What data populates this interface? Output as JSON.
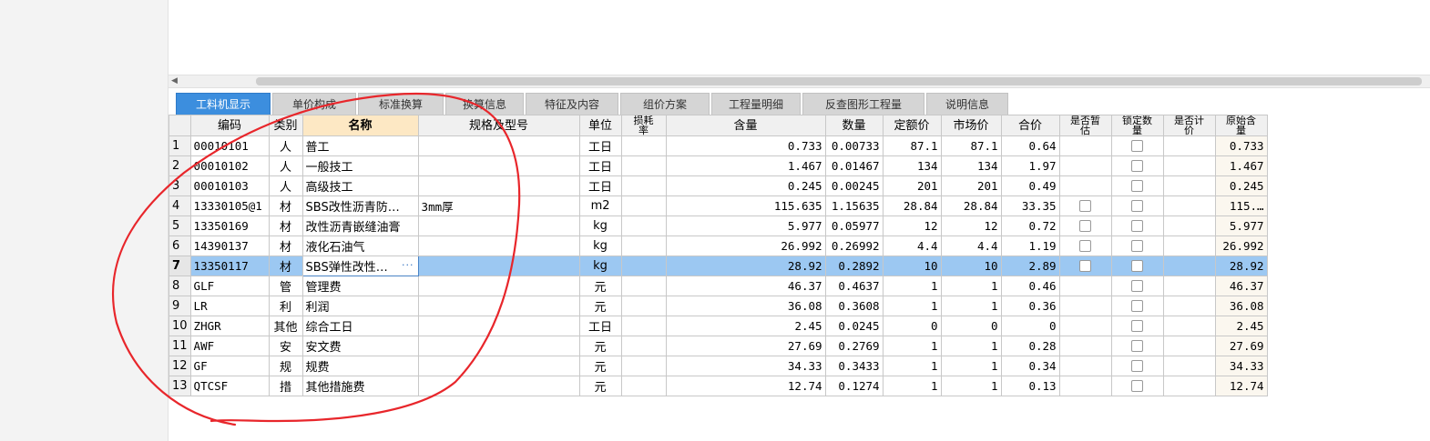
{
  "tabs": [
    {
      "label": "工料机显示",
      "active": true
    },
    {
      "label": "单价构成",
      "active": false
    },
    {
      "label": "标准换算",
      "active": false
    },
    {
      "label": "换算信息",
      "active": false
    },
    {
      "label": "特征及内容",
      "active": false
    },
    {
      "label": "组价方案",
      "active": false
    },
    {
      "label": "工程量明细",
      "active": false
    },
    {
      "label": "反查图形工程量",
      "active": false
    },
    {
      "label": "说明信息",
      "active": false
    }
  ],
  "columns": {
    "code": "编码",
    "type": "类别",
    "name": "名称",
    "spec": "规格及型号",
    "unit": "单位",
    "loss_top": "损耗",
    "loss_bot": "率",
    "content": "含量",
    "qty": "数量",
    "quota_price": "定额价",
    "market_price": "市场价",
    "total": "合价",
    "est_top": "是否暂",
    "est_bot": "估",
    "lock_top": "锁定数",
    "lock_bot": "量",
    "price_top": "是否计",
    "price_bot": "价",
    "orig_top": "原始含",
    "orig_bot": "量"
  },
  "rows": [
    {
      "rn": "1",
      "code": "00010101",
      "type": "人",
      "name": "普工",
      "spec": "",
      "unit": "工日",
      "content": "0.733",
      "qty": "0.00733",
      "quota": "87.1",
      "market": "87.1",
      "total": "0.64",
      "est": false,
      "orig": "0.733"
    },
    {
      "rn": "2",
      "code": "00010102",
      "type": "人",
      "name": "一般技工",
      "spec": "",
      "unit": "工日",
      "content": "1.467",
      "qty": "0.01467",
      "quota": "134",
      "market": "134",
      "total": "1.97",
      "est": false,
      "orig": "1.467"
    },
    {
      "rn": "3",
      "code": "00010103",
      "type": "人",
      "name": "高级技工",
      "spec": "",
      "unit": "工日",
      "content": "0.245",
      "qty": "0.00245",
      "quota": "201",
      "market": "201",
      "total": "0.49",
      "est": false,
      "orig": "0.245"
    },
    {
      "rn": "4",
      "code": "13330105@1",
      "type": "材",
      "name": "SBS改性沥青防…",
      "spec": "3mm厚",
      "unit": "m2",
      "content": "115.635",
      "qty": "1.15635",
      "quota": "28.84",
      "market": "28.84",
      "total": "33.35",
      "est": true,
      "orig": "115.…"
    },
    {
      "rn": "5",
      "code": "13350169",
      "type": "材",
      "name": "改性沥青嵌缝油膏",
      "spec": "",
      "unit": "kg",
      "content": "5.977",
      "qty": "0.05977",
      "quota": "12",
      "market": "12",
      "total": "0.72",
      "est": true,
      "orig": "5.977"
    },
    {
      "rn": "6",
      "code": "14390137",
      "type": "材",
      "name": "液化石油气",
      "spec": "",
      "unit": "kg",
      "content": "26.992",
      "qty": "0.26992",
      "quota": "4.4",
      "market": "4.4",
      "total": "1.19",
      "est": true,
      "orig": "26.992"
    },
    {
      "rn": "7",
      "code": "13350117",
      "type": "材",
      "name": "SBS弹性改性…",
      "spec": "",
      "unit": "kg",
      "content": "28.92",
      "qty": "0.2892",
      "quota": "10",
      "market": "10",
      "total": "2.89",
      "est": true,
      "orig": "28.92",
      "selected": true
    },
    {
      "rn": "8",
      "code": "GLF",
      "type": "管",
      "name": "管理费",
      "spec": "",
      "unit": "元",
      "content": "46.37",
      "qty": "0.4637",
      "quota": "1",
      "market": "1",
      "total": "0.46",
      "est": false,
      "orig": "46.37"
    },
    {
      "rn": "9",
      "code": "LR",
      "type": "利",
      "name": "利润",
      "spec": "",
      "unit": "元",
      "content": "36.08",
      "qty": "0.3608",
      "quota": "1",
      "market": "1",
      "total": "0.36",
      "est": false,
      "orig": "36.08"
    },
    {
      "rn": "10",
      "code": "ZHGR",
      "type": "其他",
      "name": "综合工日",
      "spec": "",
      "unit": "工日",
      "content": "2.45",
      "qty": "0.0245",
      "quota": "0",
      "market": "0",
      "total": "0",
      "est": false,
      "orig": "2.45"
    },
    {
      "rn": "11",
      "code": "AWF",
      "type": "安",
      "name": "安文费",
      "spec": "",
      "unit": "元",
      "content": "27.69",
      "qty": "0.2769",
      "quota": "1",
      "market": "1",
      "total": "0.28",
      "est": false,
      "orig": "27.69"
    },
    {
      "rn": "12",
      "code": "GF",
      "type": "规",
      "name": "规费",
      "spec": "",
      "unit": "元",
      "content": "34.33",
      "qty": "0.3433",
      "quota": "1",
      "market": "1",
      "total": "0.34",
      "est": false,
      "orig": "34.33"
    },
    {
      "rn": "13",
      "code": "QTCSF",
      "type": "措",
      "name": "其他措施费",
      "spec": "",
      "unit": "元",
      "content": "12.74",
      "qty": "0.1274",
      "quota": "1",
      "market": "1",
      "total": "0.13",
      "est": false,
      "orig": "12.74"
    }
  ],
  "colors": {
    "accent": "#3c8ede",
    "selected_row": "#9cc8f2",
    "annotation": "#e8262b"
  }
}
